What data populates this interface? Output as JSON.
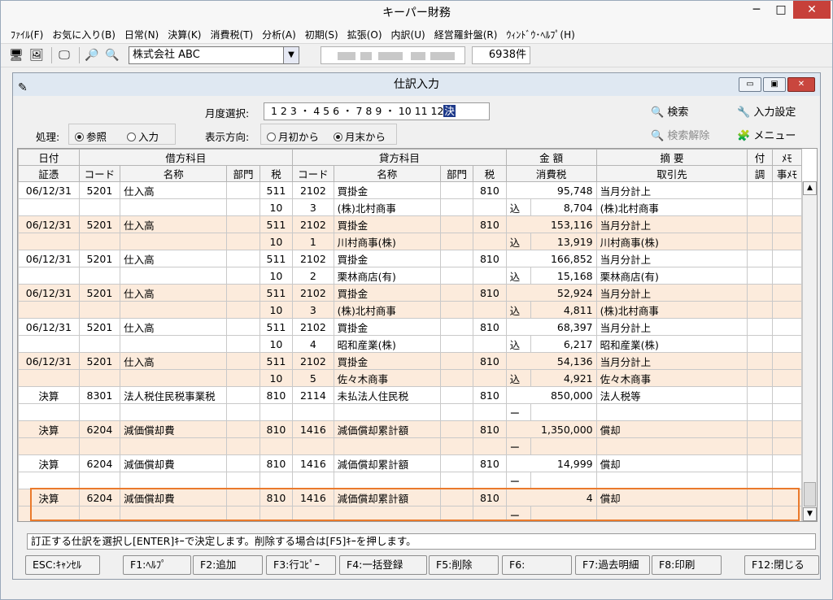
{
  "window": {
    "title": "キーパー財務",
    "minimize": "─",
    "maximize": "□",
    "close": "✕"
  },
  "menu": [
    "ﾌｧｲﾙ(F)",
    "お気に入り(B)",
    "日常(N)",
    "決算(K)",
    "消費税(T)",
    "分析(A)",
    "初期(S)",
    "拡張(O)",
    "内訳(U)",
    "経営羅針盤(R)",
    "ｳｨﾝﾄﾞｳ･ﾍﾙﾌﾟ(H)"
  ],
  "toolbar": {
    "company": "株式会社 ABC",
    "record_count": "6938件"
  },
  "dialog": {
    "title": "仕訳入力",
    "month_label": "月度選択:",
    "months": "1 2 3 ・ 4 5 6 ・ 7 8 9 ・ 10 11 12",
    "month_selected": "決",
    "process_label": "処理:",
    "process_ref": "参照",
    "process_input": "入力",
    "direction_label": "表示方向:",
    "dir_start": "月初から",
    "dir_end": "月末から",
    "search": "検索",
    "search_clear": "検索解除",
    "input_settings": "入力設定",
    "menu": "メニュー"
  },
  "grid": {
    "header1": {
      "date": "日付",
      "debit": "借方科目",
      "credit": "貸方科目",
      "amount": "金 額",
      "summary": "摘 要",
      "attach": "付",
      "memo": "ﾒﾓ"
    },
    "header2": {
      "voucher": "証憑",
      "code": "コード",
      "name": "名称",
      "dept": "部門",
      "tax": "税",
      "code2": "コード",
      "name2": "名称",
      "dept2": "部門",
      "tax2": "税",
      "ctax": "消費税",
      "partner": "取引先",
      "tone": "調",
      "memo2": "事ﾒﾓ"
    },
    "rows": [
      {
        "date": "06/12/31",
        "dc": "5201",
        "dn": "仕入高",
        "dt": "511",
        "cc": "2102",
        "cn": "買掛金",
        "ct": "810",
        "amt": "95,748",
        "sum": "当月分計上",
        "t": "10",
        "c2": "3",
        "partner_name": "(株)北村商事",
        "ins": "込",
        "tax_amt": "8,704",
        "partner": "(株)北村商事",
        "alt": false
      },
      {
        "date": "06/12/31",
        "dc": "5201",
        "dn": "仕入高",
        "dt": "511",
        "cc": "2102",
        "cn": "買掛金",
        "ct": "810",
        "amt": "153,116",
        "sum": "当月分計上",
        "t": "10",
        "c2": "1",
        "partner_name": "川村商事(株)",
        "ins": "込",
        "tax_amt": "13,919",
        "partner": "川村商事(株)",
        "alt": true
      },
      {
        "date": "06/12/31",
        "dc": "5201",
        "dn": "仕入高",
        "dt": "511",
        "cc": "2102",
        "cn": "買掛金",
        "ct": "810",
        "amt": "166,852",
        "sum": "当月分計上",
        "t": "10",
        "c2": "2",
        "partner_name": "栗林商店(有)",
        "ins": "込",
        "tax_amt": "15,168",
        "partner": "栗林商店(有)",
        "alt": false
      },
      {
        "date": "06/12/31",
        "dc": "5201",
        "dn": "仕入高",
        "dt": "511",
        "cc": "2102",
        "cn": "買掛金",
        "ct": "810",
        "amt": "52,924",
        "sum": "当月分計上",
        "t": "10",
        "c2": "3",
        "partner_name": "(株)北村商事",
        "ins": "込",
        "tax_amt": "4,811",
        "partner": "(株)北村商事",
        "alt": true
      },
      {
        "date": "06/12/31",
        "dc": "5201",
        "dn": "仕入高",
        "dt": "511",
        "cc": "2102",
        "cn": "買掛金",
        "ct": "810",
        "amt": "68,397",
        "sum": "当月分計上",
        "t": "10",
        "c2": "4",
        "partner_name": "昭和産業(株)",
        "ins": "込",
        "tax_amt": "6,217",
        "partner": "昭和産業(株)",
        "alt": false
      },
      {
        "date": "06/12/31",
        "dc": "5201",
        "dn": "仕入高",
        "dt": "511",
        "cc": "2102",
        "cn": "買掛金",
        "ct": "810",
        "amt": "54,136",
        "sum": "当月分計上",
        "t": "10",
        "c2": "5",
        "partner_name": "佐々木商事",
        "ins": "込",
        "tax_amt": "4,921",
        "partner": "佐々木商事",
        "alt": true
      },
      {
        "date": "決算",
        "dc": "8301",
        "dn": "法人税住民税事業税",
        "dt": "810",
        "cc": "2114",
        "cn": "未払法人住民税",
        "ct": "810",
        "amt": "850,000",
        "sum": "法人税等",
        "t": "",
        "c2": "",
        "partner_name": "",
        "ins": "ー",
        "tax_amt": "",
        "partner": "",
        "alt": false
      },
      {
        "date": "決算",
        "dc": "6204",
        "dn": "減価償却費",
        "dt": "810",
        "cc": "1416",
        "cn": "減価償却累計額",
        "ct": "810",
        "amt": "1,350,000",
        "sum": "償却",
        "t": "",
        "c2": "",
        "partner_name": "",
        "ins": "ー",
        "tax_amt": "",
        "partner": "",
        "alt": true
      },
      {
        "date": "決算",
        "dc": "6204",
        "dn": "減価償却費",
        "dt": "810",
        "cc": "1416",
        "cn": "減価償却累計額",
        "ct": "810",
        "amt": "14,999",
        "sum": "償却",
        "t": "",
        "c2": "",
        "partner_name": "",
        "ins": "ー",
        "tax_amt": "",
        "partner": "",
        "alt": false
      },
      {
        "date": "決算",
        "dc": "6204",
        "dn": "減価償却費",
        "dt": "810",
        "cc": "1416",
        "cn": "減価償却累計額",
        "ct": "810",
        "amt": "4",
        "sum": "償却",
        "t": "",
        "c2": "",
        "partner_name": "",
        "ins": "ー",
        "tax_amt": "",
        "partner": "",
        "alt": true
      }
    ]
  },
  "status": "訂正する仕訳を選択し[ENTER]ｷｰで決定します。削除する場合は[F5]ｷｰを押します。",
  "fkeys": [
    "ESC:ｷｬﾝｾﾙ",
    "F1:ﾍﾙﾌﾟ",
    "F2:追加",
    "F3:行ｺﾋﾟｰ",
    "F4:一括登録",
    "F5:削除",
    "F6:",
    "F7:過去明細",
    "F8:印刷",
    "F12:閉じる"
  ],
  "colors": {
    "alt_row": "#fcebdc",
    "selection": "#ea7a2c",
    "close": "#c7403a"
  }
}
